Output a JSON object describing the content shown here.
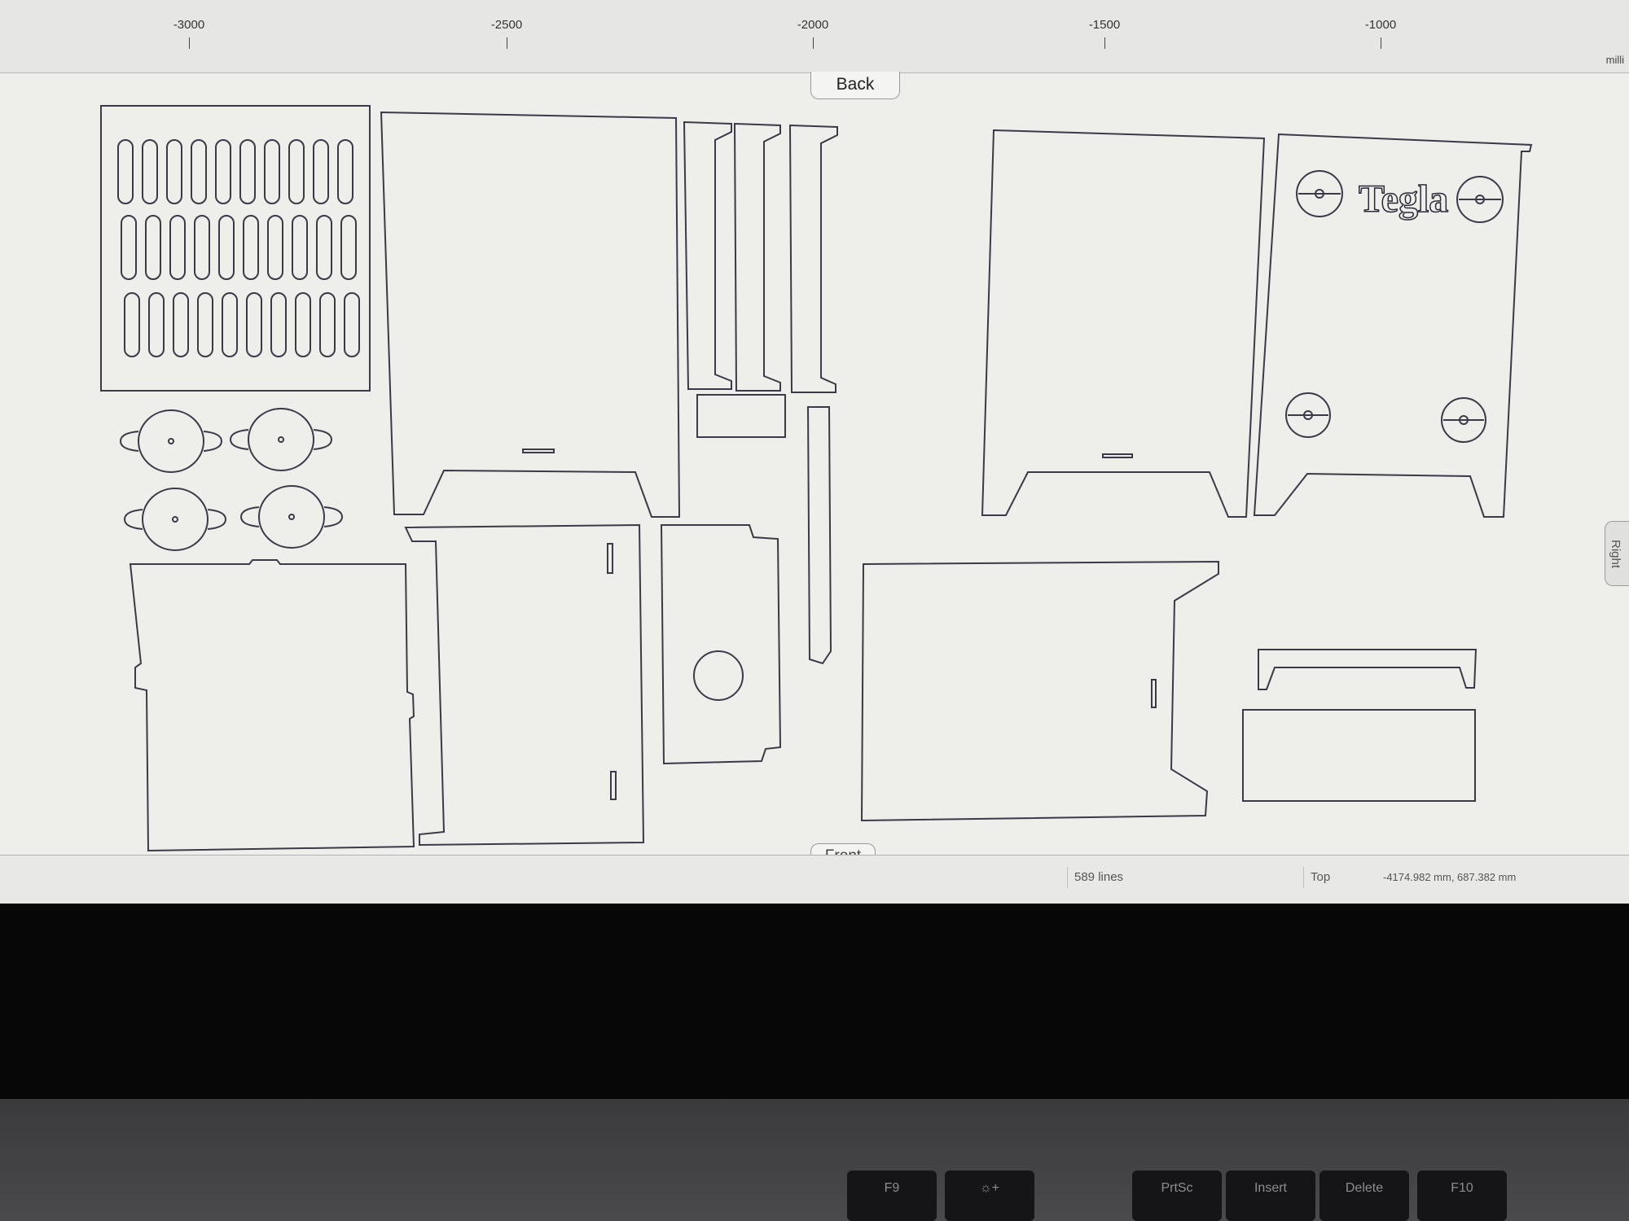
{
  "ruler": {
    "labels": [
      "-3000",
      "-2500",
      "-2000",
      "-1500",
      "-1000"
    ],
    "unit": "milli"
  },
  "view_tabs": {
    "top_tab": "Back",
    "bottom_tab": "Front",
    "right_tab": "Right"
  },
  "drawing": {
    "engraved_text": "Tegla"
  },
  "statusbar": {
    "line_count": "589 lines",
    "view_name": "Top",
    "coordinates": "-4174.982 mm, 687.382 mm"
  },
  "keyboard": {
    "keys": [
      "F9",
      "☼+",
      "PrtSc",
      "Insert",
      "Delete",
      "F10"
    ]
  },
  "colors": {
    "canvas_background": "#eeeeeb",
    "line_color": "#3a3a48",
    "bezel": "#070708"
  }
}
